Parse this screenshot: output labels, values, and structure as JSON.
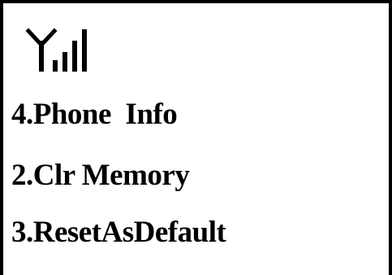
{
  "status_bar": {
    "icon": "signal-strength-icon"
  },
  "menu": {
    "items": [
      {
        "label": "4.Phone  Info"
      },
      {
        "label": "2.Clr Memory"
      },
      {
        "label": "3.ResetAsDefault"
      }
    ]
  },
  "colors": {
    "foreground": "#000000",
    "background": "#ffffff"
  }
}
